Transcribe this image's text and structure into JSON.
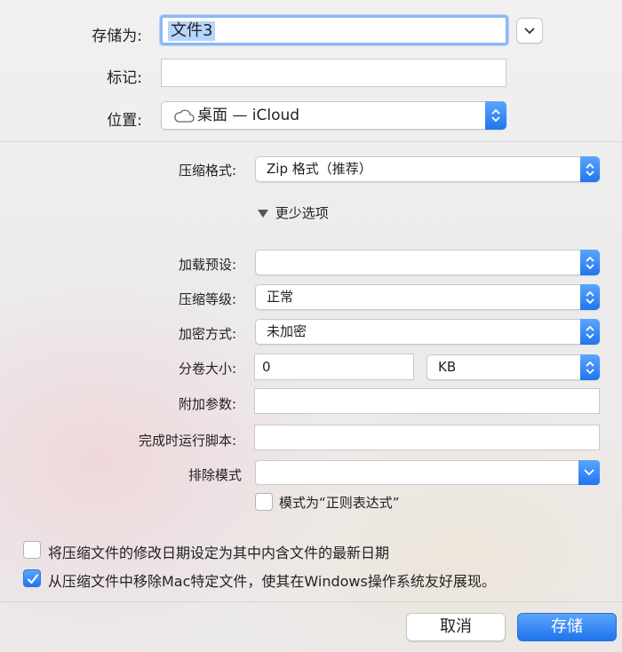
{
  "top": {
    "save_as_label": "存储为:",
    "save_as_value": "文件3",
    "tags_label": "标记:",
    "tags_value": "",
    "location_label": "位置:",
    "location_value": "桌面 — iCloud"
  },
  "options": {
    "format_label": "压缩格式:",
    "format_value": "Zip 格式（推荐）",
    "less_options_label": "更少选项",
    "preset_label": "加载预设:",
    "preset_value": "",
    "level_label": "压缩等级:",
    "level_value": "正常",
    "encryption_label": "加密方式:",
    "encryption_value": "未加密",
    "split_label": "分卷大小:",
    "split_value": "0",
    "split_unit": "KB",
    "params_label": "附加参数:",
    "params_value": "",
    "script_label": "完成时运行脚本:",
    "script_value": "",
    "exclude_label": "排除模式",
    "exclude_value": "",
    "regex_label": "模式为“正则表达式”",
    "regex_checked": false
  },
  "checks": {
    "set_date_label": "将压缩文件的修改日期设定为其中内含文件的最新日期",
    "set_date_checked": false,
    "remove_mac_label": "从压缩文件中移除Mac特定文件，使其在Windows操作系统友好展现。",
    "remove_mac_checked": true
  },
  "buttons": {
    "cancel": "取消",
    "save": "存储"
  },
  "colors": {
    "accent": "#2f7ef5",
    "selection": "#b5d5ff",
    "focus_ring": "#7fb1f5"
  }
}
